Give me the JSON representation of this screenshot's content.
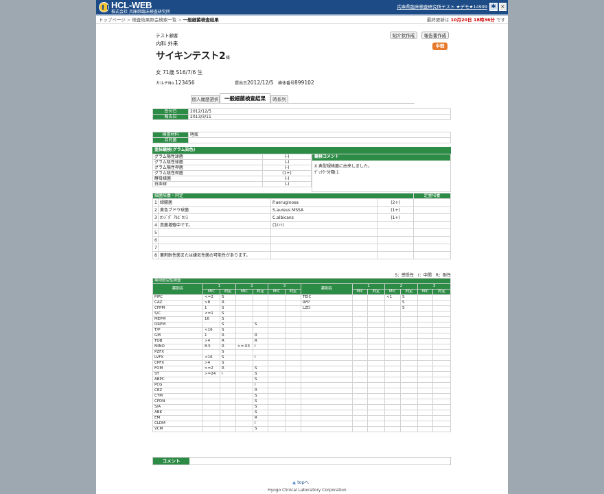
{
  "header": {
    "brand": "HCL-WEB",
    "company": "株式会社 兵庫県臨床検査研究所",
    "user": "兵庫県臨床検査研究所テスト ★デモ★14999",
    "help_glyph": "✱",
    "close_glyph": "×"
  },
  "breadcrumb": {
    "items": [
      "トップページ",
      "検査結果照会検索一覧"
    ],
    "current": "一般細菌検査結果",
    "sep": ">"
  },
  "updated": {
    "label": "最終更新は",
    "date": "10月20日 18時36分",
    "suffix": "です"
  },
  "patient": {
    "facility": "テスト顧客",
    "dept": "内科",
    "ward": "外来",
    "name": "サイキンテスト2",
    "honorific": "様",
    "gender": "女",
    "age": "71歳",
    "birth": "S16/7/6 生",
    "karte_label": "カルテNo.",
    "karte": "123456",
    "submit_label": "提出日",
    "submit": "2012/12/5",
    "specimen_label": "検体番号",
    "specimen": "899102"
  },
  "buttons": {
    "intro": "紹介状作成",
    "report": "報告書作成",
    "status": "中間"
  },
  "tabs": [
    {
      "label": "個人履歴選択"
    },
    {
      "label": "一般細菌検査結果"
    },
    {
      "label": "時系列"
    }
  ],
  "dates": [
    {
      "label": "受付日",
      "value": "2012/12/5"
    },
    {
      "label": "報告日",
      "value": "2013/3/11"
    }
  ],
  "material": [
    {
      "label": "検査材料",
      "value": "喀痰"
    },
    {
      "label": "目的菌",
      "value": ""
    }
  ],
  "gram": {
    "title": "塗抹鏡検(グラム染色)",
    "rows": [
      {
        "name": "グラム陽性球菌",
        "value": "(-)"
      },
      {
        "name": "グラム陰性球菌",
        "value": "(-)"
      },
      {
        "name": "グラム陽性桿菌",
        "value": "(-)"
      },
      {
        "name": "グラム陰性桿菌",
        "value": "(1+)"
      },
      {
        "name": "酵母様菌",
        "value": "(-)"
      },
      {
        "name": "白血球",
        "value": "(-)"
      }
    ],
    "comment_title": "鏡検コメント",
    "comments": [
      "X 典型規格菌に由来しました。",
      "ｹﾞｯｸﾗｰ分類:1"
    ]
  },
  "culture": {
    "title": "細菌培養・同定",
    "quant_title": "定量培養",
    "rows": [
      {
        "no": "1",
        "name": "緑膿菌",
        "latin": "P.aeruginosa",
        "amount": "(2+)"
      },
      {
        "no": "2",
        "name": "黄色ブドウ球菌",
        "latin": "S.aureus MSSA",
        "amount": "(1+)"
      },
      {
        "no": "3",
        "name": "ｶﾝｼﾞﾀﾞ ｱﾙﾋﾞｶﾝｽ",
        "latin": "C.albicans",
        "amount": "(1+)"
      },
      {
        "no": "4",
        "name": "真菌増殖中です。",
        "latin": "(ｺﾒﾝﾄ)",
        "amount": ""
      },
      {
        "no": "5",
        "name": "",
        "latin": "",
        "amount": ""
      },
      {
        "no": "6",
        "name": "",
        "latin": "",
        "amount": ""
      },
      {
        "no": "7",
        "name": "",
        "latin": "",
        "amount": ""
      },
      {
        "no": "8",
        "name": "薬剤耐性菌または嫌気性菌の可能性があります。",
        "latin": "",
        "amount": ""
      }
    ]
  },
  "legend": "S：感受性　I：中間　R：耐性",
  "sens": {
    "title": "薬剤感受性検査",
    "drug_col": "薬剤名",
    "group_headers": [
      "1",
      "2",
      "3"
    ],
    "mic": "MIC",
    "judge": "判定",
    "left": [
      [
        "PIPC",
        "<=2",
        "S",
        "",
        "",
        "",
        ""
      ],
      [
        "CAZ",
        ">8",
        "R",
        "",
        "",
        "",
        ""
      ],
      [
        "CFPM",
        "1",
        "S",
        "",
        "",
        "",
        ""
      ],
      [
        "S/C",
        "<=1",
        "S",
        "",
        "",
        "",
        ""
      ],
      [
        "MEPM",
        "16",
        "S",
        "",
        "",
        "",
        ""
      ],
      [
        "DRPM",
        "",
        "S",
        "",
        "S",
        "",
        ""
      ],
      [
        "T/P",
        "<16",
        "S",
        "",
        "",
        "",
        ""
      ],
      [
        "GM",
        "1",
        "R",
        "",
        "R",
        "",
        ""
      ],
      [
        "TOB",
        ">4",
        "R",
        "",
        "R",
        "",
        ""
      ],
      [
        "MINO",
        "8.5",
        "R",
        ">=.03",
        "I",
        "",
        ""
      ],
      [
        "PZFX",
        "",
        "S",
        "",
        "",
        "",
        ""
      ],
      [
        "LVFX",
        "<16",
        "S",
        "",
        "I",
        "",
        ""
      ],
      [
        "CPFX",
        ">4",
        "S",
        "",
        "",
        "",
        ""
      ],
      [
        "FOM",
        ">=2",
        "R",
        "",
        "S",
        "",
        ""
      ],
      [
        "ST",
        ">=24",
        "I",
        "",
        "S",
        "",
        ""
      ],
      [
        "ABPC",
        "",
        "",
        "",
        "S",
        "",
        ""
      ],
      [
        "PCG",
        "",
        "",
        "",
        "I",
        "",
        ""
      ],
      [
        "CEZ",
        "",
        "",
        "",
        "R",
        "",
        ""
      ],
      [
        "CTM",
        "",
        "",
        "",
        "S",
        "",
        ""
      ],
      [
        "CFDN",
        "",
        "",
        "",
        "S",
        "",
        ""
      ],
      [
        "S/A",
        "",
        "",
        "",
        "S",
        "",
        ""
      ],
      [
        "ABK",
        "",
        "",
        "",
        "S",
        "",
        ""
      ],
      [
        "EM",
        "",
        "",
        "",
        "R",
        "",
        ""
      ],
      [
        "CLDM",
        "",
        "",
        "",
        "I",
        "",
        ""
      ],
      [
        "VCM",
        "",
        "",
        "",
        "S",
        "",
        ""
      ]
    ],
    "right": [
      [
        "TEIC",
        "",
        "",
        "<1",
        "S",
        "",
        ""
      ],
      [
        "RFP",
        "",
        "",
        "",
        "S",
        "",
        ""
      ],
      [
        "LZD",
        "",
        "",
        "",
        "S",
        "",
        ""
      ]
    ]
  },
  "comment": {
    "label": "コメント"
  },
  "footer": {
    "top": "topへ",
    "top_glyph": "▲",
    "org": "Hyogo Clinical Laboratory Corporation"
  }
}
